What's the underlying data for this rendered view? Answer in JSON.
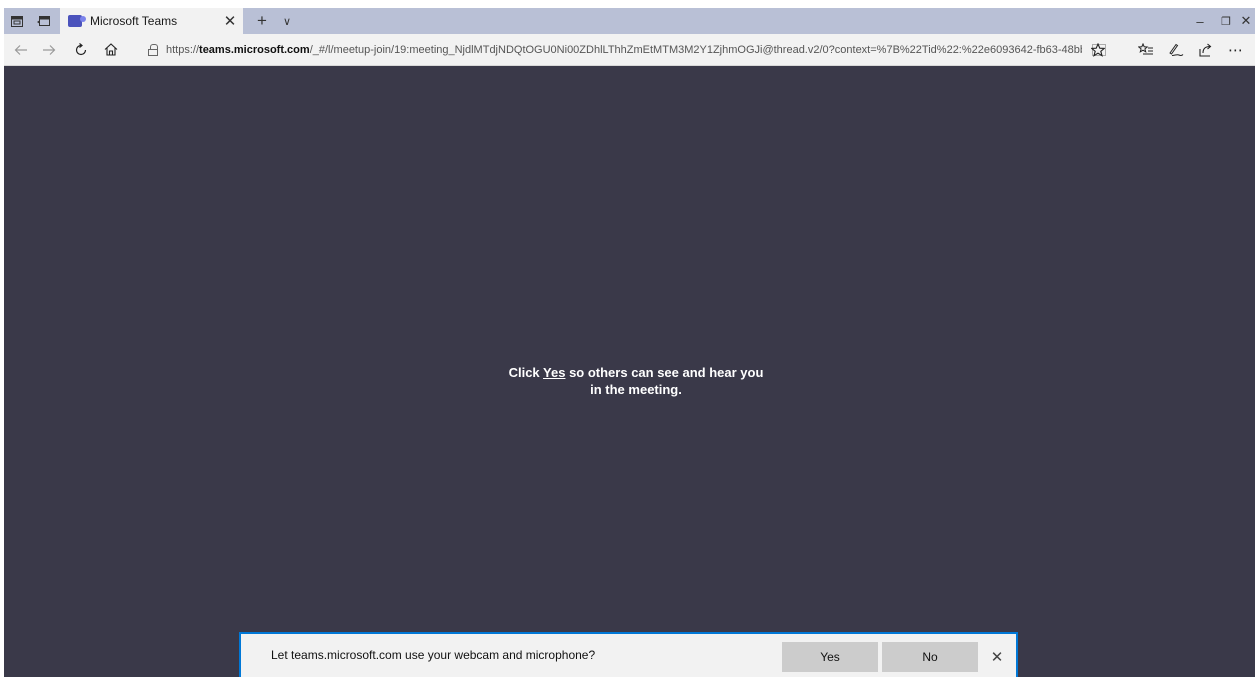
{
  "browser": {
    "tab": {
      "title": "Microsoft Teams",
      "close_glyph": "✕"
    },
    "new_tab_glyph": "+",
    "tab_list_glyph": "∨",
    "window_controls": {
      "minimize": "–",
      "maximize": "❐",
      "close": "✕"
    },
    "address_bar": {
      "url_prefix": "https://",
      "url_domain": "teams.microsoft.com",
      "url_path": "/_#/l/meetup-join/19:meeting_NjdlMTdjNDQtOGU0Ni00ZDhlLThhZmEtMTM3M2Y1ZjhmOGJi@thread.v2/0?context=%7B%22Tid%22:%22e6093642-fb63-48bb-"
    },
    "icons": {
      "set_aside_tabs": "tabs-aside-icon",
      "show_aside_tabs": "tabs-show-icon",
      "back": "back-arrow-icon",
      "forward": "forward-arrow-icon",
      "refresh": "refresh-icon",
      "home": "home-icon",
      "lock": "lock-icon",
      "reading_view": "reading-view-icon",
      "favorite": "star-icon",
      "favorites_hub": "favorites-hub-icon",
      "notes": "pen-icon",
      "share": "share-icon",
      "more": "more-icon"
    }
  },
  "page": {
    "message_before": "Click ",
    "message_yes": "Yes",
    "message_after": " so others can see and hear you in the meeting."
  },
  "permission_prompt": {
    "message": "Let teams.microsoft.com use your webcam and microphone?",
    "yes_label": "Yes",
    "no_label": "No",
    "close_glyph": "✕"
  },
  "colors": {
    "content_background": "#3a3949",
    "tab_strip": "#b9c0d6",
    "prompt_border": "#0078d7"
  }
}
